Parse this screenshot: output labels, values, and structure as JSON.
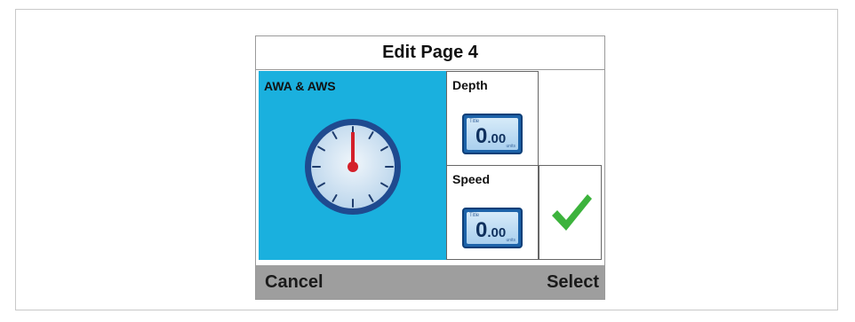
{
  "dialog": {
    "title": "Edit Page 4"
  },
  "tiles": {
    "awa": {
      "label": "AWA & AWS",
      "icon": "analog-gauge-icon",
      "background": "#1ab0de"
    },
    "depth": {
      "label": "Depth",
      "icon": "digital-display-icon",
      "display_title": "Title",
      "display_value_int": "0",
      "display_value_dec": ".00",
      "display_units": "units"
    },
    "speed": {
      "label": "Speed",
      "icon": "digital-display-icon",
      "display_title": "Title",
      "display_value_int": "0",
      "display_value_dec": ".00",
      "display_units": "units"
    },
    "select": {
      "icon": "checkmark-icon",
      "color": "#3cb33c"
    }
  },
  "softkeys": {
    "left": "Cancel",
    "right": "Select",
    "background": "#9e9e9e"
  }
}
